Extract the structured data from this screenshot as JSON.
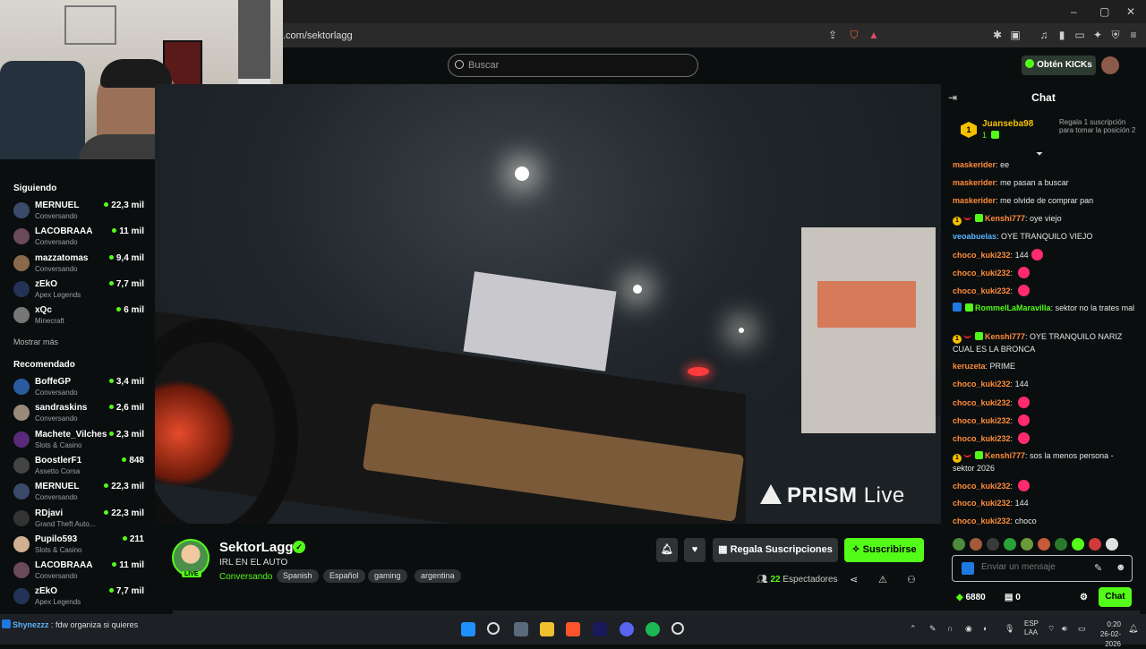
{
  "browser": {
    "url": ".com/sektorlagg",
    "win_minimize": "–",
    "win_maximize": "▢",
    "win_close": "✕"
  },
  "header": {
    "search_placeholder": "Buscar",
    "kicks_button": "Obtén KICKs"
  },
  "sidebar": {
    "following_heading": "Siguiendo",
    "following": [
      {
        "name": "MERNUEL",
        "category": "Conversando",
        "viewers": "22,3 mil",
        "avatar_color": "#3a4a6a"
      },
      {
        "name": "LACOBRAAA",
        "category": "Conversando",
        "viewers": "11 mil",
        "avatar_color": "#6a4a5a"
      },
      {
        "name": "mazzatomas",
        "category": "Conversando",
        "viewers": "9,4 mil",
        "avatar_color": "#8a6a4a"
      },
      {
        "name": "zEkO",
        "category": "Apex Legends",
        "viewers": "7,7 mil",
        "avatar_color": "#223355"
      },
      {
        "name": "xQc",
        "category": "Minecraft",
        "viewers": "6 mil",
        "avatar_color": "#777777"
      }
    ],
    "show_more": "Mostrar más",
    "recommended_heading": "Recomendado",
    "recommended": [
      {
        "name": "BoffeGP",
        "category": "Conversando",
        "viewers": "3,4 mil",
        "avatar_color": "#2a5aa0"
      },
      {
        "name": "sandraskins",
        "category": "Conversando",
        "viewers": "2,6 mil",
        "avatar_color": "#9a8a7a"
      },
      {
        "name": "Machete_Vilches",
        "category": "Slots & Casino",
        "viewers": "2,3 mil",
        "avatar_color": "#5a2a7a"
      },
      {
        "name": "BoostlerF1",
        "category": "Assetto Corsa",
        "viewers": "848",
        "avatar_color": "#444444"
      },
      {
        "name": "MERNUEL",
        "category": "Conversando",
        "viewers": "22,3 mil",
        "avatar_color": "#3a4a6a"
      },
      {
        "name": "RDjavi",
        "category": "Grand Theft Auto...",
        "viewers": "22,3 mil",
        "avatar_color": "#333333"
      },
      {
        "name": "Pupilo593",
        "category": "Slots & Casino",
        "viewers": "211",
        "avatar_color": "#d0b090"
      },
      {
        "name": "LACOBRAAA",
        "category": "Conversando",
        "viewers": "11 mil",
        "avatar_color": "#6a4a5a"
      },
      {
        "name": "zEkO",
        "category": "Apex Legends",
        "viewers": "7,7 mil",
        "avatar_color": "#223355"
      }
    ]
  },
  "video": {
    "watermark_brand": "PRISM",
    "watermark_live": "Live"
  },
  "stream": {
    "channel": "SektorLagg",
    "live_badge": "LIVE",
    "verified_mark": "✓",
    "title": "IRL EN EL AUTO",
    "category": "Conversando",
    "tags": [
      "Spanish",
      "Español",
      "gaming",
      "argentina"
    ],
    "gift_button": "Regala Suscripciones",
    "subscribe_button": "Suscribirse",
    "viewers_count": "22",
    "viewers_label": "Espectadores"
  },
  "chat": {
    "title": "Chat",
    "pinned": {
      "user": "Juanseba98",
      "rank": "1",
      "count": "1",
      "text": "Regala 1 suscripción para tomar la posición 2"
    },
    "messages": [
      {
        "user": "maskerider",
        "text": "ee",
        "color": "#ff8c3a",
        "badges": [],
        "emotes": 0
      },
      {
        "user": "maskerider",
        "text": "me pasan a buscar",
        "color": "#ff8c3a",
        "badges": [],
        "emotes": 0
      },
      {
        "user": "maskerider",
        "text": "me olvide de comprar pan",
        "color": "#ff8c3a",
        "badges": [],
        "emotes": 0
      },
      {
        "user": "Kenshi777",
        "text": "oye viejo",
        "color": "#ff8c3a",
        "badges": [
          "1",
          "r",
          "g"
        ],
        "emotes": 0
      },
      {
        "user": "veoabuelas",
        "text": "OYE TRANQUILO VIEJO",
        "color": "#5ab4ff",
        "badges": [],
        "emotes": 0
      },
      {
        "user": "choco_kuki232",
        "text": "144",
        "color": "#ff8c3a",
        "badges": [],
        "emotes": 1
      },
      {
        "user": "choco_kuki232",
        "text": "",
        "color": "#ff8c3a",
        "badges": [],
        "emotes": 1
      },
      {
        "user": "choco_kuki232",
        "text": "",
        "color": "#ff8c3a",
        "badges": [],
        "emotes": 1
      },
      {
        "user": "RommelLaMaravilla",
        "text": "sektor no la trates mal",
        "color": "#53fc18",
        "badges": [
          "b",
          "v"
        ],
        "emotes": 0
      },
      {
        "user": "Kenshi777",
        "text": "OYE TRANQUILO NARIZ CUAL ES LA BRONCA",
        "color": "#ff8c3a",
        "badges": [
          "1",
          "r",
          "g"
        ],
        "emotes": 0
      },
      {
        "user": "keruzeta",
        "text": "PRIME",
        "color": "#ff8c3a",
        "badges": [],
        "emotes": 0
      },
      {
        "user": "choco_kuki232",
        "text": "144",
        "color": "#ff8c3a",
        "badges": [],
        "emotes": 0
      },
      {
        "user": "choco_kuki232",
        "text": "",
        "color": "#ff8c3a",
        "badges": [],
        "emotes": 1
      },
      {
        "user": "choco_kuki232",
        "text": "",
        "color": "#ff8c3a",
        "badges": [],
        "emotes": 1
      },
      {
        "user": "choco_kuki232",
        "text": "",
        "color": "#ff8c3a",
        "badges": [],
        "emotes": 1
      },
      {
        "user": "Kenshi777",
        "text": "sos la menos persona - sektor 2026",
        "color": "#ff8c3a",
        "badges": [
          "1",
          "r",
          "g"
        ],
        "emotes": 0
      },
      {
        "user": "choco_kuki232",
        "text": "",
        "color": "#ff8c3a",
        "badges": [],
        "emotes": 1
      },
      {
        "user": "choco_kuki232",
        "text": "144",
        "color": "#ff8c3a",
        "badges": [],
        "emotes": 0
      },
      {
        "user": "choco_kuki232",
        "text": "choco",
        "color": "#ff8c3a",
        "badges": [],
        "emotes": 0
      }
    ],
    "input_placeholder": "Enviar un mensaje",
    "points": "6880",
    "gifts": "0",
    "send_button": "Chat"
  },
  "taskbar": {
    "overlay_user": "Shynezzz",
    "overlay_text": ": fdw organiza si quieres",
    "lang_top": "ESP",
    "lang_bottom": "LAA",
    "time": "0:20",
    "date": "26-02-2026"
  }
}
